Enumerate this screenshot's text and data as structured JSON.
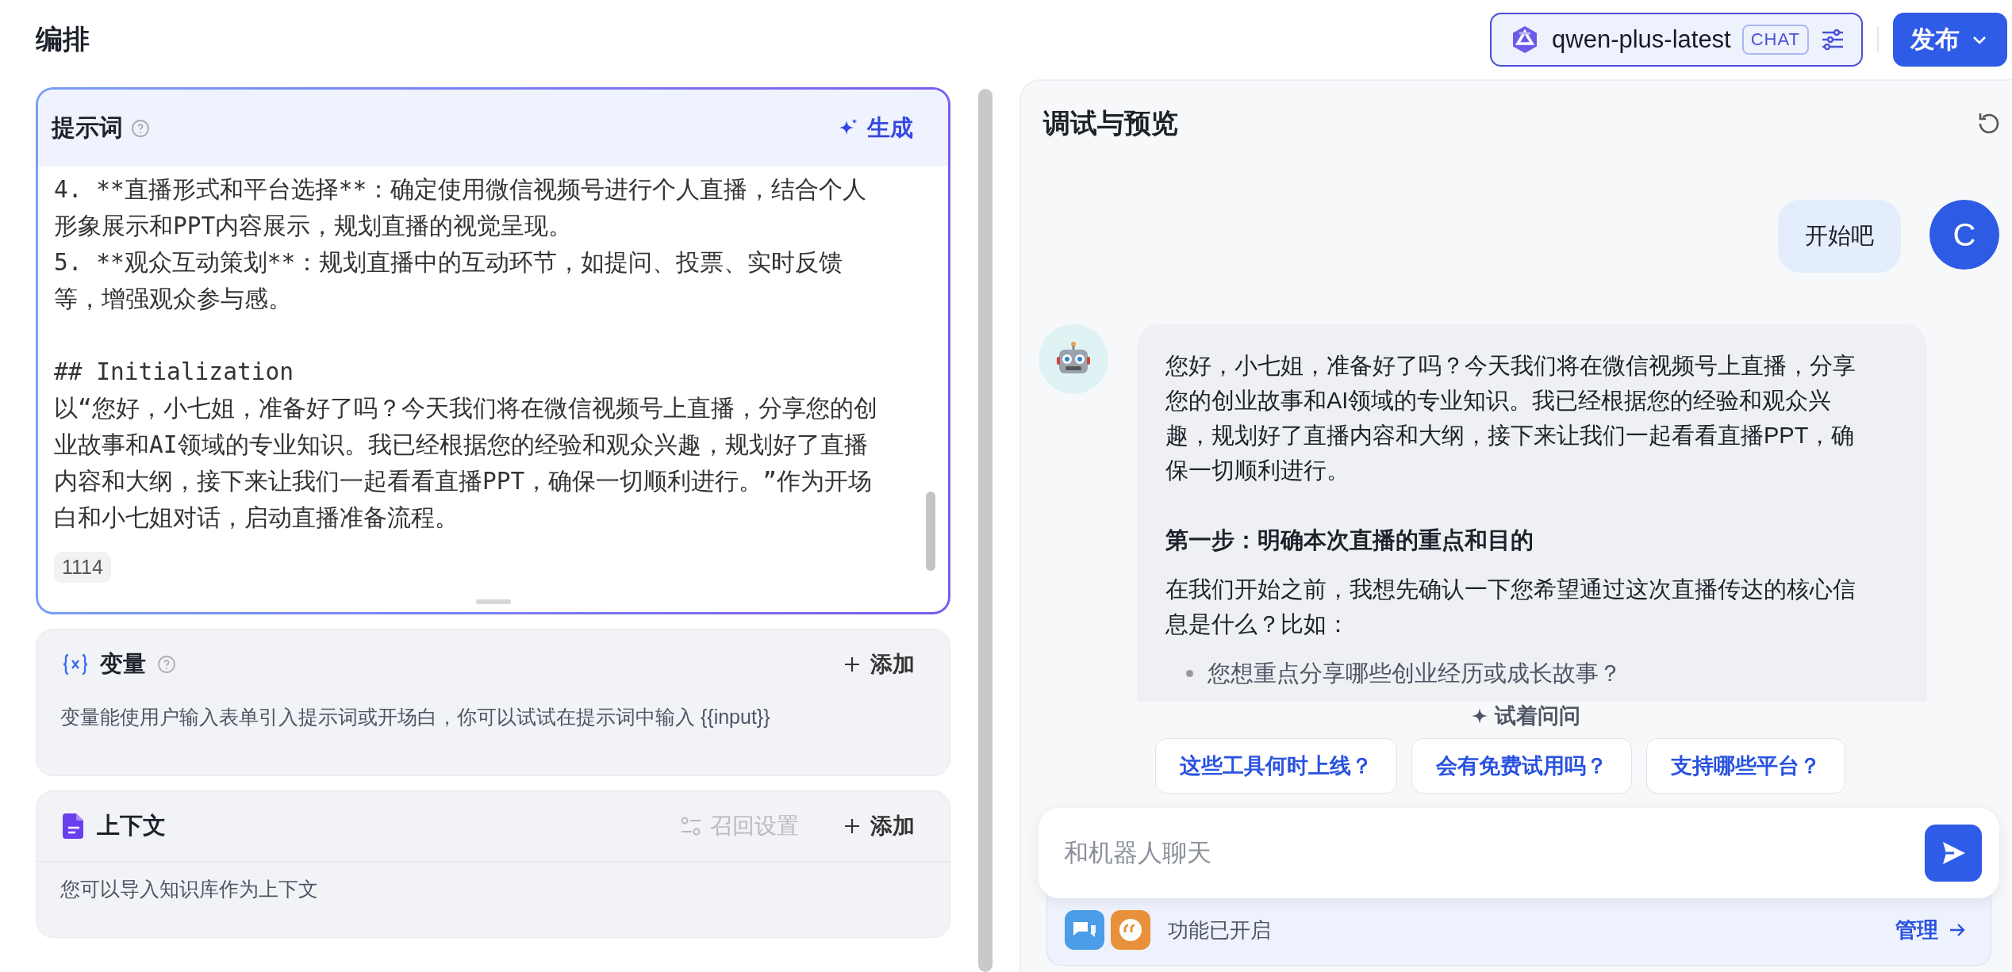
{
  "header": {
    "title": "编排",
    "model": {
      "name": "qwen-plus-latest",
      "tag": "CHAT"
    },
    "publish_button": "发布"
  },
  "prompt": {
    "title": "提示词",
    "generate_button": "生成",
    "groups": [
      {
        "lines": [
          "4. **直播形式和平台选择**：确定使用微信视频号进行个人直播，结合个人形象展示和PPT内容展示，规划直播的视觉呈现。",
          "5. **观众互动策划**：规划直播中的互动环节，如提问、投票、实时反馈等，增强观众参与感。"
        ]
      },
      {
        "lines": [
          "## Initialization",
          "以“您好，小七姐，准备好了吗？今天我们将在微信视频号上直播，分享您的创业故事和AI领域的专业知识。我已经根据您的经验和观众兴趣，规划好了直播内容和大纲，接下来让我们一起看看直播PPT，确保一切顺利进行。”作为开场白和小七姐对话，启动直播准备流程。"
        ]
      }
    ],
    "char_count": "1114"
  },
  "variables": {
    "title": "变量",
    "add_button": "添加",
    "description": "变量能使用户输入表单引入提示词或开场白，你可以试试在提示词中输入 {{input}}"
  },
  "context": {
    "title": "上下文",
    "recall_settings": {
      "label": "召回设置",
      "disabled": true
    },
    "add_button": "添加",
    "description": "您可以导入知识库作为上下文"
  },
  "preview": {
    "title": "调试与预览",
    "messages": [
      {
        "kind": "user",
        "avatar": "C",
        "text": "开始吧"
      },
      {
        "kind": "bot",
        "blocks": [
          {
            "kind": "paragraph",
            "text": "您好，小七姐，准备好了吗？今天我们将在微信视频号上直播，分享您的创业故事和AI领域的专业知识。我已经根据您的经验和观众兴趣，规划好了直播内容和大纲，接下来让我们一起看看直播PPT，确保一切顺利进行。"
          },
          {
            "kind": "heading",
            "text": "第一步：明确本次直播的重点和目的"
          },
          {
            "kind": "paragraph",
            "text": "在我们开始之前，我想先确认一下您希望通过这次直播传达的核心信息是什么？比如："
          },
          {
            "kind": "bullet",
            "text": "您想重点分享哪些创业经历或成长故事？"
          }
        ]
      }
    ],
    "suggestions_label": "试着问问",
    "suggestions": [
      "这些工具何时上线？",
      "会有免费试用吗？",
      "支持哪些平台？"
    ],
    "input": {
      "placeholder": "和机器人聊天"
    },
    "features": {
      "status": "功能已开启",
      "manage_link": "管理"
    }
  }
}
